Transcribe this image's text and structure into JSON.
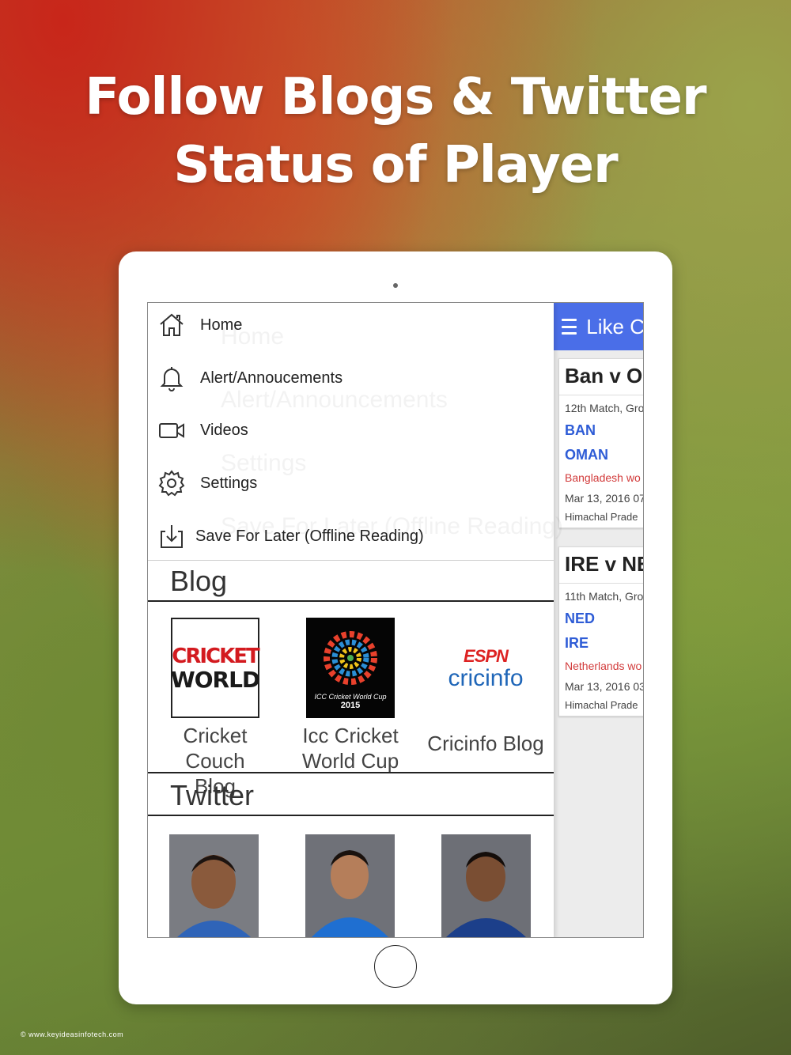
{
  "headline": {
    "line1": "Follow Blogs & Twitter",
    "line2": "Status of Player"
  },
  "copyright": "© www.keyideasinfotech.com",
  "background_app": {
    "title": "Like C",
    "accent_color": "#4a6ee8",
    "matches": [
      {
        "title": "Ban v OM",
        "subtitle": "12th Match, Gro",
        "team1": "BAN",
        "team2": "OMAN",
        "result": "Bangladesh wo",
        "date": "Mar 13, 2016 07",
        "venue": "Himachal Prade"
      },
      {
        "title": "IRE v NEI",
        "subtitle": "11th Match, Gro",
        "team1": "NED",
        "team2": "IRE",
        "result": "Netherlands wo",
        "date": "Mar 13, 2016 03",
        "venue": "Himachal Prade"
      }
    ]
  },
  "ghost_menu": [
    "Home",
    "Alert/Announcements",
    "Settings",
    "Save For Later (Offline Reading)"
  ],
  "drawer": {
    "menu": [
      {
        "label": "Home",
        "icon": "home-icon"
      },
      {
        "label": "Alert/Annoucements",
        "icon": "bell-icon"
      },
      {
        "label": "Videos",
        "icon": "video-icon"
      },
      {
        "label": "Settings",
        "icon": "gear-icon"
      },
      {
        "label": "Save For Later (Offline Reading)",
        "icon": "download-icon"
      }
    ],
    "blog_heading": "Blog",
    "blogs": [
      {
        "label_line1": "Cricket Couch",
        "label_line2": "Blog",
        "logo_line1": "CRICKET",
        "logo_line2": "WORLD"
      },
      {
        "label_line1": "Icc Cricket",
        "label_line2": "World Cup",
        "logo_text": "ICC Cricket World Cup",
        "logo_year": "2015"
      },
      {
        "label_line1": "Cricinfo Blog",
        "logo_top": "ESPN",
        "logo_bottom": "cricinfo"
      }
    ],
    "twitter_heading": "Twitter",
    "players": [
      "player-photo-1",
      "player-photo-2",
      "player-photo-3"
    ]
  }
}
